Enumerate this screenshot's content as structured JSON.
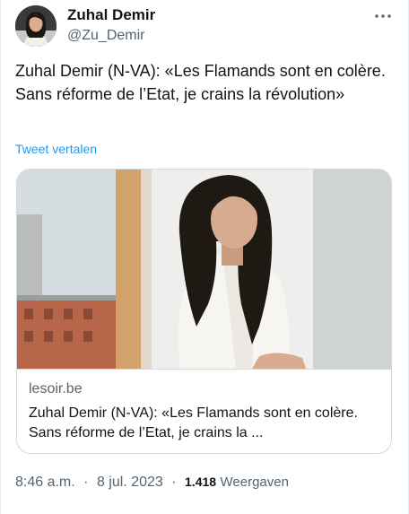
{
  "author": {
    "display_name": "Zuhal Demir",
    "handle": "@Zu_Demir"
  },
  "tweet": {
    "text": "Zuhal Demir (N-VA): «Les Flamands sont en colère. Sans réforme de l’Etat, je crains la révolution»",
    "translate_label": "Tweet vertalen"
  },
  "card": {
    "domain": "lesoir.be",
    "title": "Zuhal Demir (N-VA): «Les Flamands sont en colère. Sans réforme de l’Etat, je crains la ..."
  },
  "meta": {
    "time": "8:46 a.m.",
    "date": "8 jul. 2023",
    "separator": "·",
    "view_count": "1.418",
    "views_label": "Weergaven"
  },
  "icons": {
    "more": "more-dots-icon"
  },
  "colors": {
    "link": "#1d9bf0",
    "secondary_text": "#536471",
    "border": "#cfd9de"
  }
}
